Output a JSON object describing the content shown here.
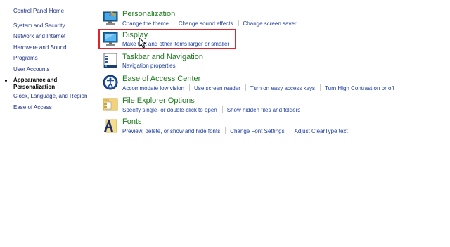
{
  "sidebar": {
    "home": "Control Panel Home",
    "items": [
      {
        "label": "System and Security"
      },
      {
        "label": "Network and Internet"
      },
      {
        "label": "Hardware and Sound"
      },
      {
        "label": "Programs"
      },
      {
        "label": "User Accounts"
      },
      {
        "label": "Appearance and",
        "label2": "Personalization",
        "active": true
      },
      {
        "label": "Clock, Language, and Region"
      },
      {
        "label": "Ease of Access"
      }
    ]
  },
  "categories": [
    {
      "title": "Personalization",
      "icon": "personalization-icon",
      "links": [
        "Change the theme",
        "Change sound effects",
        "Change screen saver"
      ]
    },
    {
      "title": "Display",
      "icon": "display-icon",
      "links": [
        "Make text and other items larger or smaller"
      ]
    },
    {
      "title": "Taskbar and Navigation",
      "icon": "taskbar-icon",
      "links": [
        "Navigation properties"
      ]
    },
    {
      "title": "Ease of Access Center",
      "icon": "ease-of-access-icon",
      "links": [
        "Accommodate low vision",
        "Use screen reader",
        "Turn on easy access keys",
        "Turn High Contrast on or off"
      ]
    },
    {
      "title": "File Explorer Options",
      "icon": "folder-options-icon",
      "links": [
        "Specify single- or double-click to open",
        "Show hidden files and folders"
      ]
    },
    {
      "title": "Fonts",
      "icon": "fonts-icon",
      "links": [
        "Preview, delete, or show and hide fonts",
        "Change Font Settings",
        "Adjust ClearType text"
      ]
    }
  ],
  "colors": {
    "category_title": "#1e7b1e",
    "link": "#1e3ea1",
    "sidebar_link": "#1e3287",
    "highlight_box": "#e0242e"
  }
}
